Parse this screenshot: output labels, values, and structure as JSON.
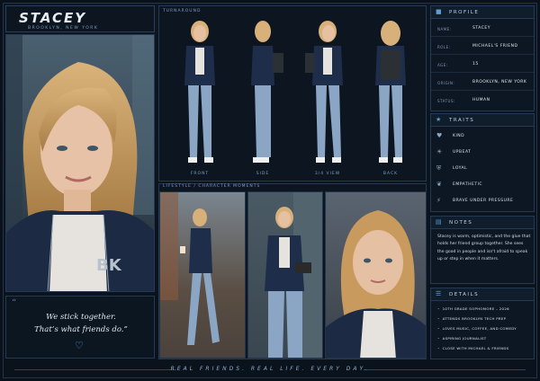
{
  "title": {
    "name": "STACEY",
    "subtitle": "BROOKLYN, NEW YORK"
  },
  "quote": {
    "mark": "“",
    "text_line1": "We stick together.",
    "text_line2": "That’s what friends do.”",
    "heart": "♡"
  },
  "turnaround": {
    "label": "TURNAROUND",
    "views": [
      "FRONT",
      "SIDE",
      "3/4 VIEW",
      "BACK"
    ]
  },
  "lifestyle": {
    "label": "LIFESTYLE / CHARACTER MOMENTS"
  },
  "profile": {
    "header": "PROFILE",
    "icon": "person-icon",
    "rows": [
      {
        "key": "NAME:",
        "value": "STACEY"
      },
      {
        "key": "ROLE:",
        "value": "MICHAEL'S FRIEND"
      },
      {
        "key": "AGE:",
        "value": "15"
      },
      {
        "key": "ORIGIN:",
        "value": "BROOKLYN, NEW YORK"
      },
      {
        "key": "STATUS:",
        "value": "HUMAN"
      }
    ]
  },
  "traits": {
    "header": "TRAITS",
    "icon": "star-icon",
    "items": [
      {
        "icon": "heart-icon",
        "glyph": "♥",
        "label": "KIND"
      },
      {
        "icon": "sun-icon",
        "glyph": "☀",
        "label": "UPBEAT"
      },
      {
        "icon": "shield-icon",
        "glyph": "⛨",
        "label": "LOYAL"
      },
      {
        "icon": "hearts-icon",
        "glyph": "❦",
        "label": "EMPATHETIC"
      },
      {
        "icon": "lightning-icon",
        "glyph": "⚡",
        "label": "BRAVE UNDER PRESSURE"
      }
    ]
  },
  "notes": {
    "header": "NOTES",
    "icon": "note-icon",
    "text": "Stacey is warm, optimistic, and the glue that holds her friend group together. She sees the good in people and isn't afraid to speak up or step in when it matters."
  },
  "details": {
    "header": "DETAILS",
    "icon": "list-icon",
    "items": [
      "10TH GRADE SOPHOMORE – 2026",
      "ATTENDS BROOKLYN TECH PREP",
      "LOVES MUSIC, COFFEE, AND COMEDY",
      "ASPIRING JOURNALIST",
      "CLOSE WITH MICHAEL & FRIENDS"
    ]
  },
  "footer": {
    "tagline": "REAL FRIENDS. REAL LIFE. EVERY DAY."
  },
  "colors": {
    "accent": "#5e9ed6",
    "background": "#0a111a",
    "panel": "#0e1824"
  }
}
